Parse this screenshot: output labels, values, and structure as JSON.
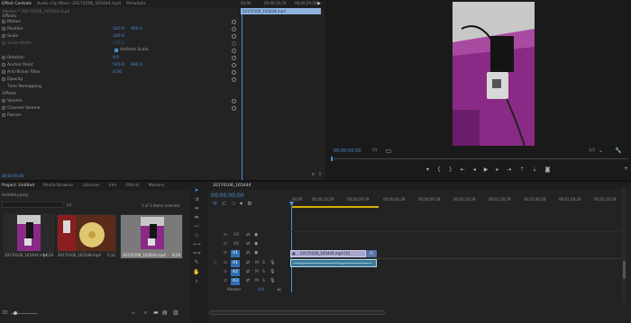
{
  "effect_controls": {
    "tabs": [
      "Effect Controls",
      "Audio Clip Mixer: 20170106_165444.mp4",
      "Metadata"
    ],
    "source_prefix": "Master * 20170106_165444.mp4",
    "clip_chevron": "20170106_165444.mp4",
    "sections": {
      "video": "Effects",
      "fx_motion": "Motion",
      "audio": "Effects"
    },
    "rows": [
      {
        "label": "Position",
        "v1": "540.0",
        "v2": "960.0"
      },
      {
        "label": "Scale",
        "v1": "100.0",
        "v2": ""
      },
      {
        "label": "Scale Width",
        "v1": "100.0",
        "v2": ""
      },
      {
        "label": "Uniform Scale",
        "v1": "",
        "v2": ""
      },
      {
        "label": "Rotation",
        "v1": "0.0",
        "v2": ""
      },
      {
        "label": "Anchor Point",
        "v1": "540.0",
        "v2": "960.0"
      },
      {
        "label": "Anti-flicker Filter",
        "v1": "0.00",
        "v2": ""
      },
      {
        "label": "Opacity",
        "v1": "",
        "v2": ""
      },
      {
        "label": "Time Remapping",
        "v1": "",
        "v2": ""
      }
    ],
    "audio_rows": [
      "Volume",
      "Channel Volume",
      "Panner"
    ],
    "timecode": "00;00;00;00",
    "mini_ruler": [
      "00;00",
      "00;00;14;29",
      "00;00;29;29"
    ],
    "mini_clip": "20170106_165444.mp4"
  },
  "program": {
    "timecode": "00;00;00;00",
    "fit": "Fit",
    "quality": "1/2",
    "icons": [
      "marker-icon",
      "in-point-icon",
      "out-point-icon",
      "goto-in-icon",
      "step-back-icon",
      "play-icon",
      "step-forward-icon",
      "goto-out-icon",
      "lift-icon",
      "extract-icon",
      "export-frame-icon"
    ]
  },
  "project": {
    "tabs": [
      "Project: Untitled",
      "Media Browser",
      "Libraries",
      "Info",
      "Effects",
      "Markers"
    ],
    "project_file": "Untitled.prproj",
    "selection": "1 of 3 items selected",
    "items": [
      {
        "name": "20170106_165444.mp4",
        "duration": "14;28"
      },
      {
        "name": "20170106_165348.mp4",
        "duration": "5;12"
      },
      {
        "name": "20170106_165444.mp4",
        "duration": "9;29"
      }
    ]
  },
  "timeline": {
    "tab": "20170106_165444",
    "timecode": "00;00;00;00",
    "ruler": [
      "00;00",
      "00;00;14;29",
      "00;00;29;29",
      "00;00;44;28",
      "00;00;59;28",
      "00;01;14;29",
      "00;01;29;29",
      "00;01;44;28",
      "00;01;59;28",
      "00;02;14;29"
    ],
    "tracks_video": [
      "V3",
      "V2",
      "V1"
    ],
    "tracks_audio": [
      "A1",
      "A2",
      "A3"
    ],
    "master": "Master",
    "master_value": "0.0",
    "video_clip": "20170106_165444.mp4 [V]",
    "sync_badge": "M"
  },
  "colors": {
    "accent": "#4a8fd6",
    "panel": "#232323",
    "playhead": "#4a8fd6",
    "work_area": "#d4b100",
    "clip_video": "#a7a7d0",
    "clip_audio": "#5da6c5"
  }
}
